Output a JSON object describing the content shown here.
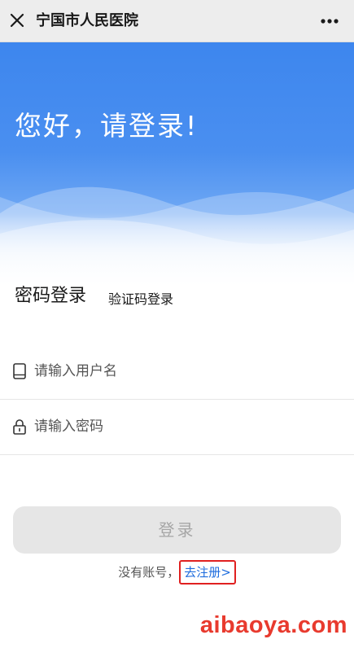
{
  "window": {
    "title": "宁国市人民医院",
    "close_icon": "close-icon",
    "more_icon": "more-horizontal-icon"
  },
  "hero": {
    "greeting": "您好，请登录!",
    "background_color": "#3d86ee"
  },
  "tabs": [
    {
      "label": "密码登录",
      "active": true
    },
    {
      "label": "验证码登录",
      "active": false
    }
  ],
  "form": {
    "username": {
      "placeholder": "请输入用户名",
      "value": "",
      "icon": "phone-icon"
    },
    "password": {
      "placeholder": "请输入密码",
      "value": "",
      "icon": "lock-icon"
    },
    "login_label": "登录"
  },
  "register": {
    "prefix": "没有账号，",
    "link": "去注册>"
  },
  "colors": {
    "accent": "#3d86ee",
    "link": "#1f6dde",
    "highlight_border": "#e02020",
    "watermark": "#e83a2e",
    "login_disabled_bg": "#e6e6e6"
  },
  "watermark": "aibaoya.com"
}
